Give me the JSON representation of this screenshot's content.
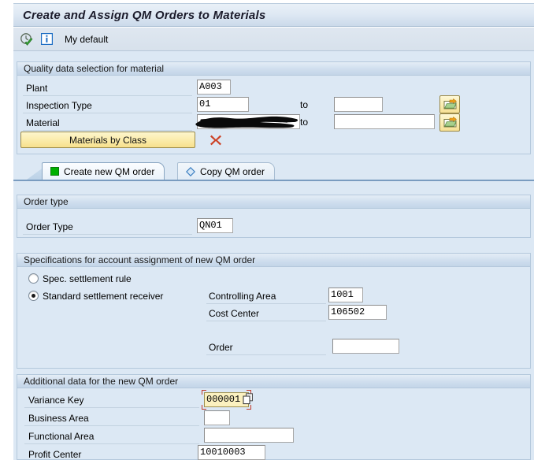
{
  "window": {
    "title": "Create and Assign QM Orders to Materials"
  },
  "toolbar": {
    "execute_icon": "execute-check-icon",
    "info_icon": "info-icon",
    "variant_label": "My default"
  },
  "selection_section": {
    "header": "Quality data selection for material",
    "to_label": "to",
    "rows": [
      {
        "label": "Plant",
        "value": "A003",
        "to_value": "",
        "has_to": false,
        "has_multi": false
      },
      {
        "label": "Inspection Type",
        "value": "01",
        "to_value": "",
        "has_to": true,
        "has_multi": true
      },
      {
        "label": "Material",
        "value": "",
        "to_value": "",
        "has_to": true,
        "has_multi": true,
        "redacted": true
      }
    ],
    "materials_by_class_button": "Materials by Class",
    "delete_icon": "red-x-icon"
  },
  "tabs": [
    {
      "label": "Create new QM order",
      "icon": "green-square-icon",
      "active": true
    },
    {
      "label": "Copy QM order",
      "icon": "blue-diamond-icon",
      "active": false
    }
  ],
  "order_type_section": {
    "header": "Order type",
    "label": "Order Type",
    "value": "QN01"
  },
  "account_assignment_section": {
    "header": "Specifications for account assignment of new QM order",
    "radio_spec_rule": "Spec. settlement rule",
    "radio_standard_receiver": "Standard settlement receiver",
    "selected_radio": "standard",
    "fields": [
      {
        "label": "Controlling Area",
        "value": "1001"
      },
      {
        "label": "Cost Center",
        "value": "106502"
      },
      {
        "label": "Order",
        "value": ""
      }
    ]
  },
  "additional_data_section": {
    "header": "Additional data for the new QM order",
    "fields": [
      {
        "label": "Variance Key",
        "value": "000001",
        "focused": true,
        "has_f4": true
      },
      {
        "label": "Business Area",
        "value": "",
        "focused": false,
        "has_f4": false
      },
      {
        "label": "Functional Area",
        "value": "",
        "focused": false,
        "has_f4": false
      },
      {
        "label": "Profit Center",
        "value": "10010003",
        "focused": false,
        "has_f4": false
      }
    ]
  },
  "colors": {
    "page_background": "#dce8f4",
    "section_border": "#b4c8dc",
    "title_text": "#1b1b2b",
    "focus_field_background": "#fbf1c0",
    "focus_frame": "#c0392b",
    "button_yellow": "#f7e08c",
    "tab_active_marker": "#00b000",
    "tab_inactive_marker": "#5b9bd5",
    "delete_x": "#cc4125"
  }
}
